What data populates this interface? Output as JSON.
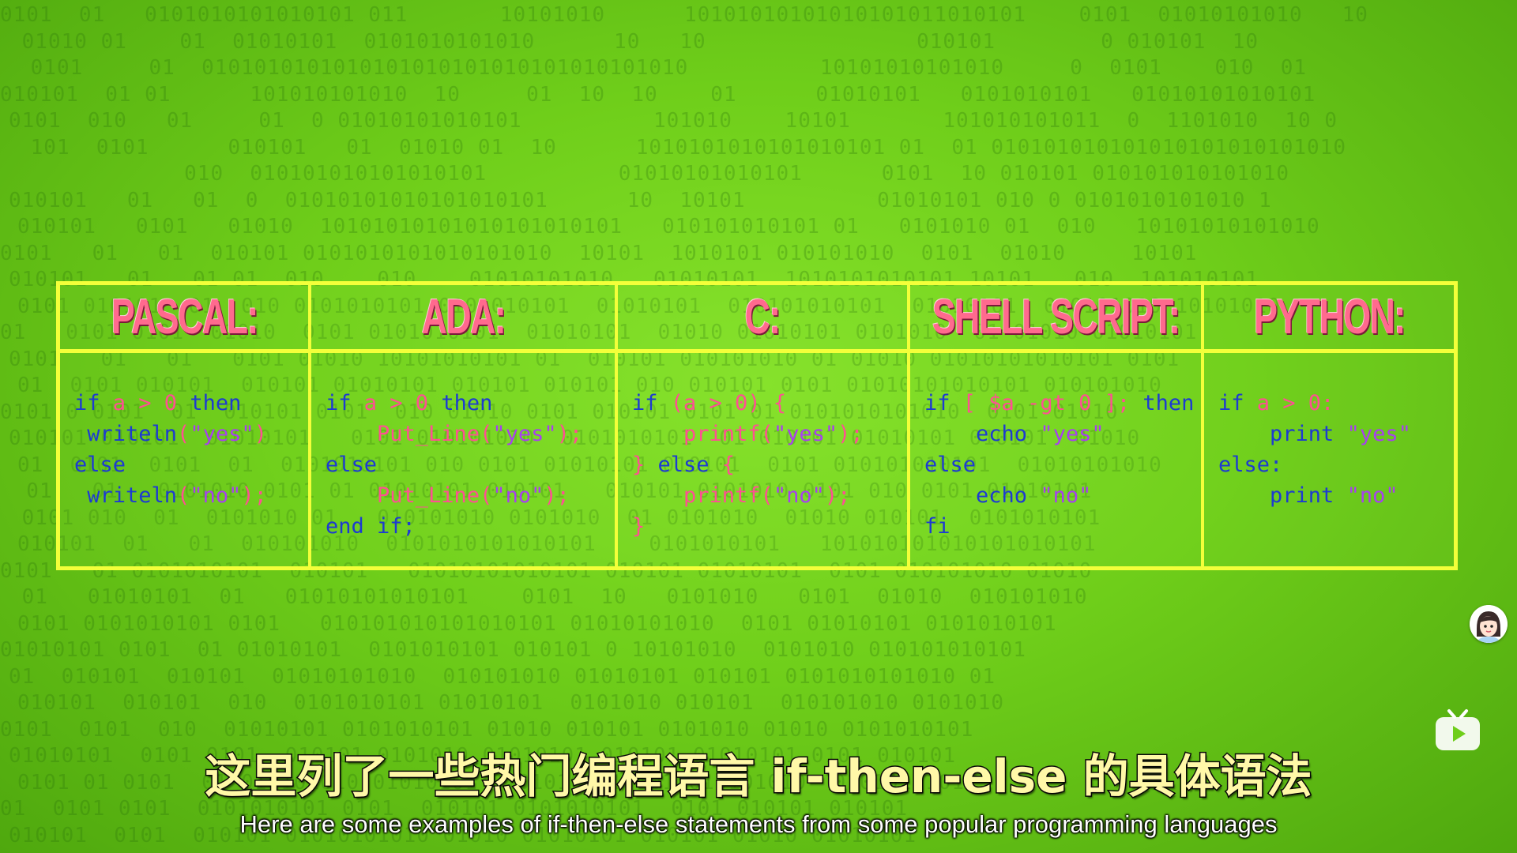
{
  "background": {
    "binary_rows": [
      "0101  01   0101010101010101 011       10101010      10101010101010101011010101    0101  01010101010   10",
      " 01010 01    01  01010101  0101010101010      10   10                010101        0 010101  10",
      " 0101     01  0101010101010101010101010101010101010          10101010101010     0  0101    010  01",
      "010101  01 01      101010101010  10     01  10  10    01      01010101   0101010101   01010101010101",
      "0101  010   01     01  0 01010101010101          101010    10101       101010101011  0  1101010  10 0",
      " 101  0101      010101   01  01010 01  10      1010101010101010101 01  01 010101010101010101010101010",
      "              010  010101010101010101          01010101010101      0101  10 010101 010101010101010",
      "010101   01   01  0  01010101010101010101      10  10101          01010101 010 0 0101010101010 1",
      "010101   0101   01010  10101010101010101010101   010101010101 01   0101010 01  010   10101010101010",
      "0101   01   01  010101 0101010101010101010  10101  1010101 010101010  0101  01010     10101",
      "010101   01   01 01  010    010    01010101010   01010101  1010101010101 10101   010  101010101",
      "0101 010101  01  010 0101010101 0101010101  01010101  010101010101  01010101  010101010 10101010",
      "01   0101 0101  01010  0101 0101010101  01010101  01010 01010101 0101010  01 01010 01010101",
      "0101   01   01   0101 01010 10101010101 01  010101 010101010 01 01010 01010101010101 0101",
      "01  0101 010101  010101 01010101 010101 010101 010 010101 0101 01010101010101 010101010",
      "0101 0 0101  01  010101 0101  010 01010 0101 010101 0101 01 0101010101010  0101 01010",
      "010101 010101  01010101   0101 010101010  0101010101  01 010101 01010101 010101  01010",
      "01  0101  0101  01  0101010101 010 0101 01010101 010101  0101 010101010101  01010101010",
      "  01   01   0101010 0101 01 01010101 010101   010101 0101010 0101 010 0101 01010101",
      " 0101 010  01  0101010 01   010101010 0101010  01 0101010  01010 010101  0101010101",
      "010101  01   01  010101010  0101010101010101    0101010101   101010101010101010101",
      "0101   01 0101010101  010101   01010101010101 010101 01010101  0101 010101010 01010",
      " 01   01010101  01   01010101010101    0101  10   0101010   0101  01010  010101010",
      "0101 0101010101 0101   010101010101010101 01010101010  0101 01010101 0101010101",
      "01010101 0101  01 01010101  0101010101 010101 0 10101010  0101010 010101010101",
      "01  010101  010101  01010101010  010101010 01010101 010101 0101010101010 01",
      "010101  010101  010  0101010101 01010101  0101010 010101  010101010 0101010",
      "0101  0101  010  01010101 0101010101 01010 010101 0101010 01010 0101010101",
      "01010101  0101 0101  010101 0101010 01010101 010101 01010101 0101 010101",
      "0101 01 0101  01 010101010 01010101 0101010 010101 010101010  0101010101",
      "01  0101 0101  0101010101 0101  010101 0101010101  0101 010101 010101",
      "010101  0101  010101 01010101010 01010 01010101 010101 01010 01010101"
    ]
  },
  "table": {
    "columns": [
      {
        "header": "PASCAL:",
        "lines": [
          [
            {
              "t": "if ",
              "c": "kw"
            },
            {
              "t": "a > 0",
              "c": "op"
            },
            {
              "t": " then",
              "c": "kw"
            }
          ],
          [
            {
              "t": " writeln",
              "c": "kw"
            },
            {
              "t": "(",
              "c": "op"
            },
            {
              "t": "\"yes\"",
              "c": "str"
            },
            {
              "t": ")",
              "c": "op"
            }
          ],
          [
            {
              "t": "else",
              "c": "kw"
            }
          ],
          [
            {
              "t": " writeln",
              "c": "kw"
            },
            {
              "t": "(",
              "c": "op"
            },
            {
              "t": "\"no\"",
              "c": "str"
            },
            {
              "t": ");",
              "c": "op"
            }
          ]
        ]
      },
      {
        "header": "ADA:",
        "lines": [
          [
            {
              "t": "if ",
              "c": "kw"
            },
            {
              "t": "a > 0",
              "c": "op"
            },
            {
              "t": " then",
              "c": "kw"
            }
          ],
          [
            {
              "t": "    Put_Line(",
              "c": "op"
            },
            {
              "t": "\"yes\"",
              "c": "str"
            },
            {
              "t": ");",
              "c": "op"
            }
          ],
          [
            {
              "t": "else",
              "c": "kw"
            }
          ],
          [
            {
              "t": "    Put_Line(",
              "c": "op"
            },
            {
              "t": "\"no\"",
              "c": "str"
            },
            {
              "t": ");",
              "c": "op"
            }
          ],
          [
            {
              "t": "end if;",
              "c": "kw"
            }
          ]
        ]
      },
      {
        "header": "C:",
        "lines": [
          [
            {
              "t": "if ",
              "c": "kw"
            },
            {
              "t": "(a > 0) {",
              "c": "op"
            }
          ],
          [
            {
              "t": "    printf(",
              "c": "op"
            },
            {
              "t": "\"yes\"",
              "c": "str"
            },
            {
              "t": ");",
              "c": "op"
            }
          ],
          [
            {
              "t": "} ",
              "c": "op"
            },
            {
              "t": "else ",
              "c": "kw"
            },
            {
              "t": "{",
              "c": "op"
            }
          ],
          [
            {
              "t": "    printf(",
              "c": "op"
            },
            {
              "t": "\"no\"",
              "c": "str"
            },
            {
              "t": ");",
              "c": "op"
            }
          ],
          [
            {
              "t": "}",
              "c": "op"
            }
          ]
        ]
      },
      {
        "header": "SHELL SCRIPT:",
        "lines": [
          [
            {
              "t": "if ",
              "c": "kw"
            },
            {
              "t": "[ $a -gt 0 ];",
              "c": "op"
            },
            {
              "t": " then",
              "c": "kw"
            }
          ],
          [
            {
              "t": "    echo ",
              "c": "kw"
            },
            {
              "t": "\"yes\"",
              "c": "str"
            }
          ],
          [
            {
              "t": "else",
              "c": "kw"
            }
          ],
          [
            {
              "t": "    echo ",
              "c": "kw"
            },
            {
              "t": "\"no\"",
              "c": "str"
            }
          ],
          [
            {
              "t": "fi",
              "c": "kw"
            }
          ]
        ]
      },
      {
        "header": "PYTHON:",
        "lines": [
          [
            {
              "t": "if ",
              "c": "kw"
            },
            {
              "t": "a > 0:",
              "c": "op"
            }
          ],
          [
            {
              "t": "    print ",
              "c": "kw"
            },
            {
              "t": "\"yes\"",
              "c": "str"
            }
          ],
          [
            {
              "t": "else:",
              "c": "kw"
            }
          ],
          [
            {
              "t": "    print ",
              "c": "kw"
            },
            {
              "t": "\"no\"",
              "c": "str"
            }
          ]
        ]
      }
    ]
  },
  "subtitles": {
    "chinese": "这里列了一些热门编程语言 if-then-else 的具体语法",
    "english": "Here are some examples of if-then-else statements from some popular programming languages"
  },
  "overlay": {
    "avatar_icon": "avatar-icon",
    "play_icon": "tv-play-icon"
  },
  "colors": {
    "border": "#f3ff3a",
    "header": "#ff6a8e",
    "keyword": "#1d3bd1",
    "operator": "#ff4f93",
    "string": "#a83ff0"
  }
}
